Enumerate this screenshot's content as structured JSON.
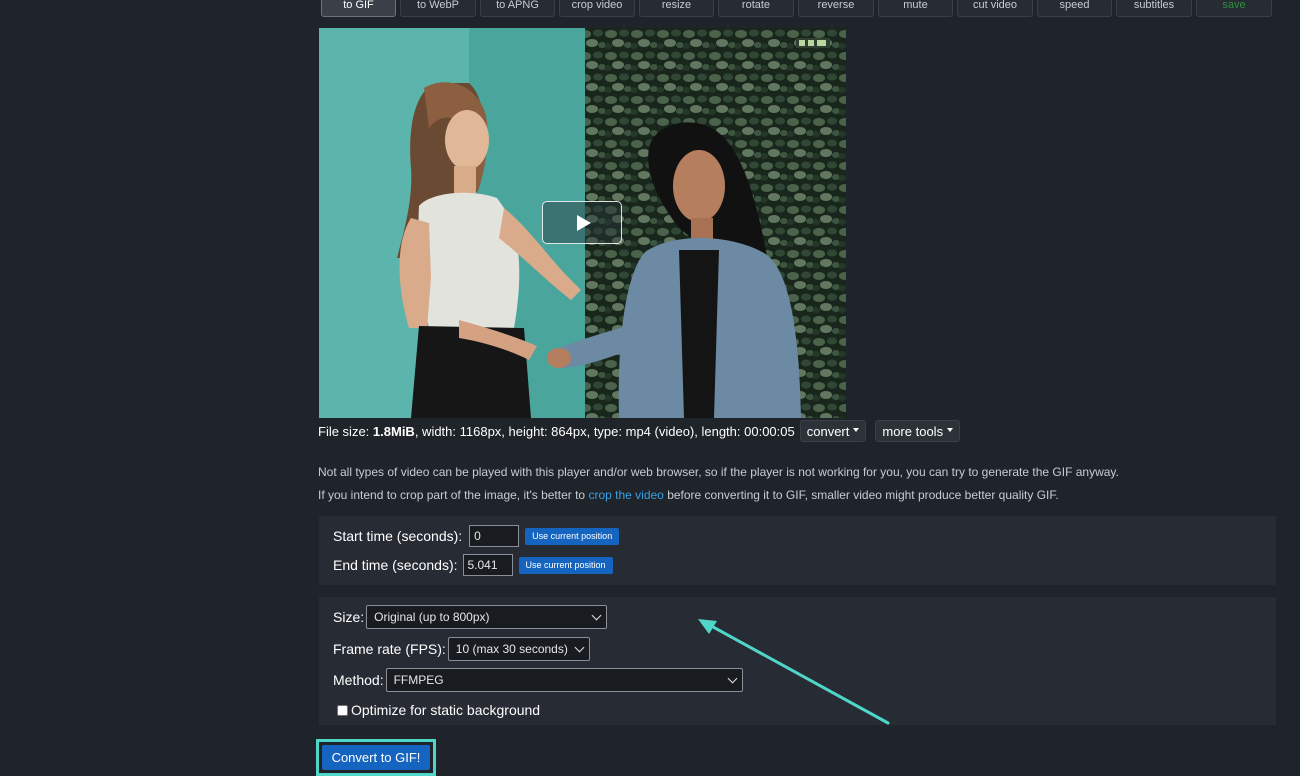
{
  "tabs": [
    "to GIF",
    "to WebP",
    "to APNG",
    "crop video",
    "resize",
    "rotate",
    "reverse",
    "mute",
    "cut video",
    "speed",
    "subtitles",
    "save"
  ],
  "active_tab": "to GIF",
  "file_info": {
    "file_size_label": "File size:",
    "file_size": "1.8MiB",
    "details": ", width: 1168px, height: 864px, type: mp4 (video), length: 00:00:05",
    "convert_label": "convert",
    "more_tools_label": "more tools"
  },
  "notes": {
    "line1": "Not all types of video can be played with this player and/or web browser, so if the player is not working for you, you can try to generate the GIF anyway.",
    "line2_before": "If you intend to crop part of the image, it's better to",
    "line2_link": "crop the video",
    "line2_after": "before converting it to GIF, smaller video might produce better quality GIF."
  },
  "time": {
    "start_label": "Start time (seconds):",
    "start_value": "0",
    "end_label": "End time (seconds):",
    "end_value": "5.041",
    "use_current_label": "Use current position"
  },
  "options": {
    "size_label": "Size:",
    "size_value": "Original (up to 800px)",
    "fps_label": "Frame rate (FPS):",
    "fps_value": "10 (max 30 seconds)",
    "method_label": "Method:",
    "method_value": "FFMPEG",
    "optimize_label": "Optimize for static background",
    "optimize_checked": false
  },
  "convert_button": "Convert to GIF!",
  "colors": {
    "background": "#1f232a",
    "panel": "#272b33",
    "accent_blue": "#1565c0",
    "link": "#3b9ee0",
    "annotation_teal": "#4fd6c8",
    "save_tab": "#2f8f3d"
  }
}
